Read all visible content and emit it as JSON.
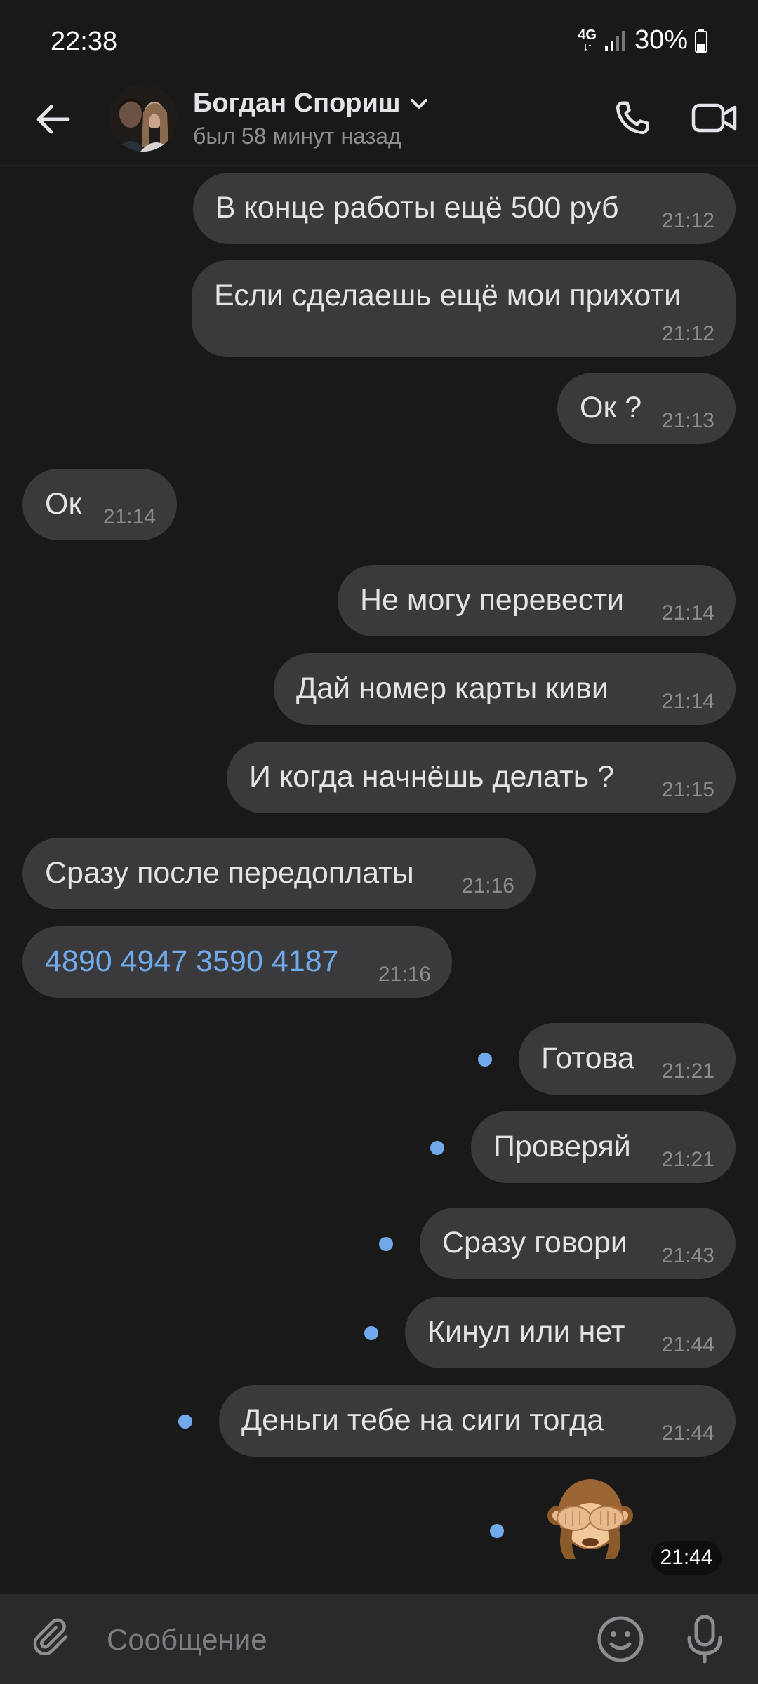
{
  "status_bar": {
    "time": "22:38",
    "network": "4G",
    "battery": "30%"
  },
  "header": {
    "name": "Богдан Спориш",
    "status": "был 58 минут назад"
  },
  "messages": [
    {
      "text": "В конце работы ещё 500 руб",
      "time": "21:12",
      "outgoing": true
    },
    {
      "text": "Если сделаешь ещё мои прихоти",
      "time": "21:12",
      "outgoing": true
    },
    {
      "text": "Ок ?",
      "time": "21:13",
      "outgoing": true
    },
    {
      "text": "Ок",
      "time": "21:14",
      "outgoing": false
    },
    {
      "text": "Не могу перевести",
      "time": "21:14",
      "outgoing": true
    },
    {
      "text": "Дай номер карты киви",
      "time": "21:14",
      "outgoing": true
    },
    {
      "text": "И когда начнёшь делать ?",
      "time": "21:15",
      "outgoing": true
    },
    {
      "text": "Сразу после передоплаты",
      "time": "21:16",
      "outgoing": false
    },
    {
      "text": "4890 4947 3590 4187",
      "time": "21:16",
      "outgoing": false
    },
    {
      "text": "Готова",
      "time": "21:21",
      "outgoing": true,
      "unread": true
    },
    {
      "text": "Проверяй",
      "time": "21:21",
      "outgoing": true,
      "unread": true
    },
    {
      "text": "Сразу говори",
      "time": "21:43",
      "outgoing": true,
      "unread": true
    },
    {
      "text": "Кинул или нет",
      "time": "21:44",
      "outgoing": true,
      "unread": true
    },
    {
      "text": "Деньги  тебе на сиги тогда",
      "time": "21:44",
      "outgoing": true,
      "unread": true
    }
  ],
  "sticker": {
    "icon": "see-no-evil-monkey",
    "time": "21:44",
    "unread": true
  },
  "composer": {
    "placeholder": "Сообщение"
  },
  "colors": {
    "background": "#19191a",
    "bubble": "#3a3a3c",
    "link": "#71aaeb",
    "unread_dot": "#71aaeb"
  }
}
